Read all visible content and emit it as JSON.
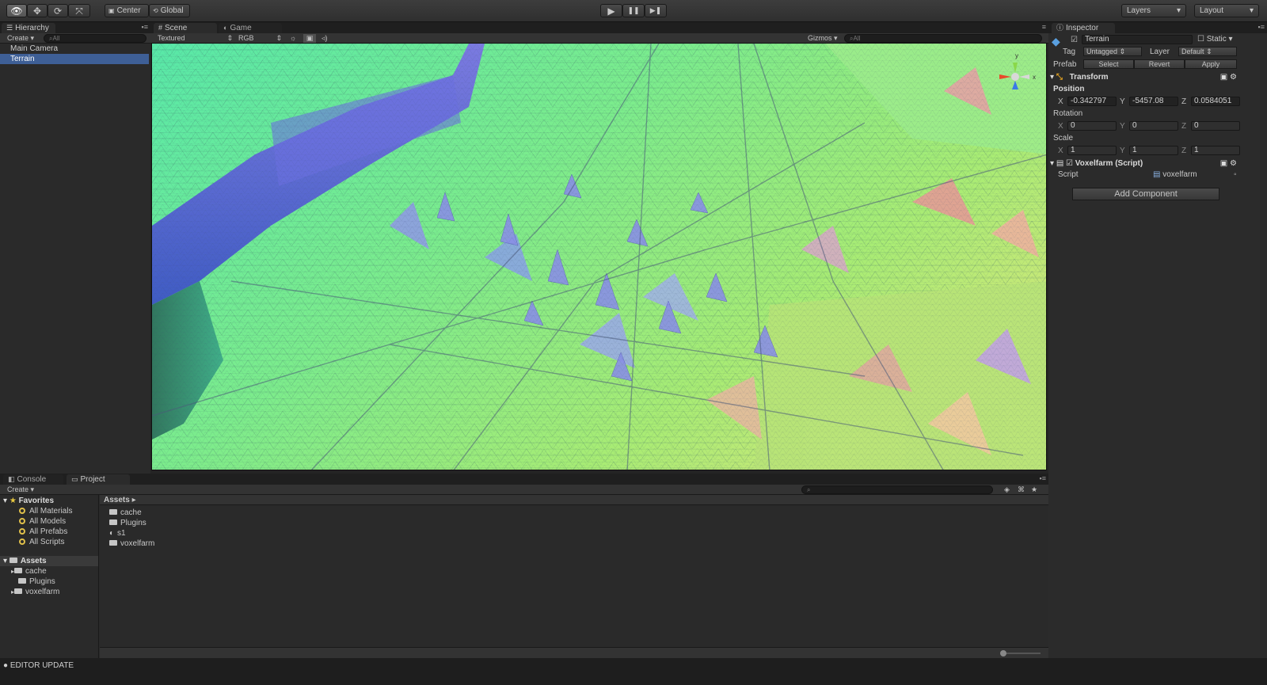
{
  "toolbar": {
    "tools": [
      {
        "name": "view-tool",
        "glyph": "👁"
      },
      {
        "name": "move-tool",
        "glyph": "✥"
      },
      {
        "name": "rotate-tool",
        "glyph": "⟳"
      },
      {
        "name": "scale-tool",
        "glyph": "⤧"
      }
    ],
    "pivot_label": "Center",
    "space_label": "Global",
    "play_glyph": "▶",
    "pause_glyph": "❚❚",
    "step_glyph": "▶❚",
    "layers_label": "Layers",
    "layout_label": "Layout"
  },
  "hierarchy": {
    "tab_label": "Hierarchy",
    "create_label": "Create",
    "search_placeholder": "All",
    "items": [
      {
        "label": "Main Camera",
        "selected": false
      },
      {
        "label": "Terrain",
        "selected": true
      }
    ]
  },
  "scene": {
    "tabs": [
      {
        "label": "Scene",
        "icon": "#",
        "active": true
      },
      {
        "label": "Game",
        "icon": "◐",
        "active": false
      }
    ],
    "render_mode": "Textured",
    "channel": "RGB",
    "gizmos_label": "Gizmos",
    "search_placeholder": "All",
    "axis_labels": {
      "y": "y",
      "x": "x"
    }
  },
  "inspector": {
    "tab_label": "Inspector",
    "object_name": "Terrain",
    "static_label": "Static",
    "tag_label": "Tag",
    "tag_value": "Untagged",
    "layer_label": "Layer",
    "layer_value": "Default",
    "prefab_label": "Prefab",
    "prefab_buttons": [
      "Select",
      "Revert",
      "Apply"
    ],
    "transform": {
      "title": "Transform",
      "position_label": "Position",
      "position": {
        "x": "-0.342797",
        "y": "-5457.08",
        "z": "0.0584051"
      },
      "rotation_label": "Rotation",
      "rotation": {
        "x": "0",
        "y": "0",
        "z": "0"
      },
      "scale_label": "Scale",
      "scale": {
        "x": "1",
        "y": "1",
        "z": "1"
      }
    },
    "script_component": {
      "title": "Voxelfarm (Script)",
      "script_label": "Script",
      "script_value": "voxelfarm"
    },
    "add_component_label": "Add Component"
  },
  "bottom": {
    "tabs": [
      {
        "label": "Console",
        "icon": "◧",
        "active": false
      },
      {
        "label": "Project",
        "icon": "▭",
        "active": true
      }
    ],
    "create_label": "Create",
    "favorites_label": "Favorites",
    "favorites": [
      "All Materials",
      "All Models",
      "All Prefabs",
      "All Scripts"
    ],
    "assets_label": "Assets",
    "asset_tree": [
      "cache",
      "Plugins",
      "voxelfarm"
    ],
    "breadcrumb": "Assets",
    "assets_list": [
      {
        "label": "cache",
        "kind": "folder"
      },
      {
        "label": "Plugins",
        "kind": "folder"
      },
      {
        "label": "s1",
        "kind": "scene"
      },
      {
        "label": "voxelfarm",
        "kind": "folder"
      }
    ]
  },
  "status": {
    "text": "EDITOR UPDATE"
  }
}
